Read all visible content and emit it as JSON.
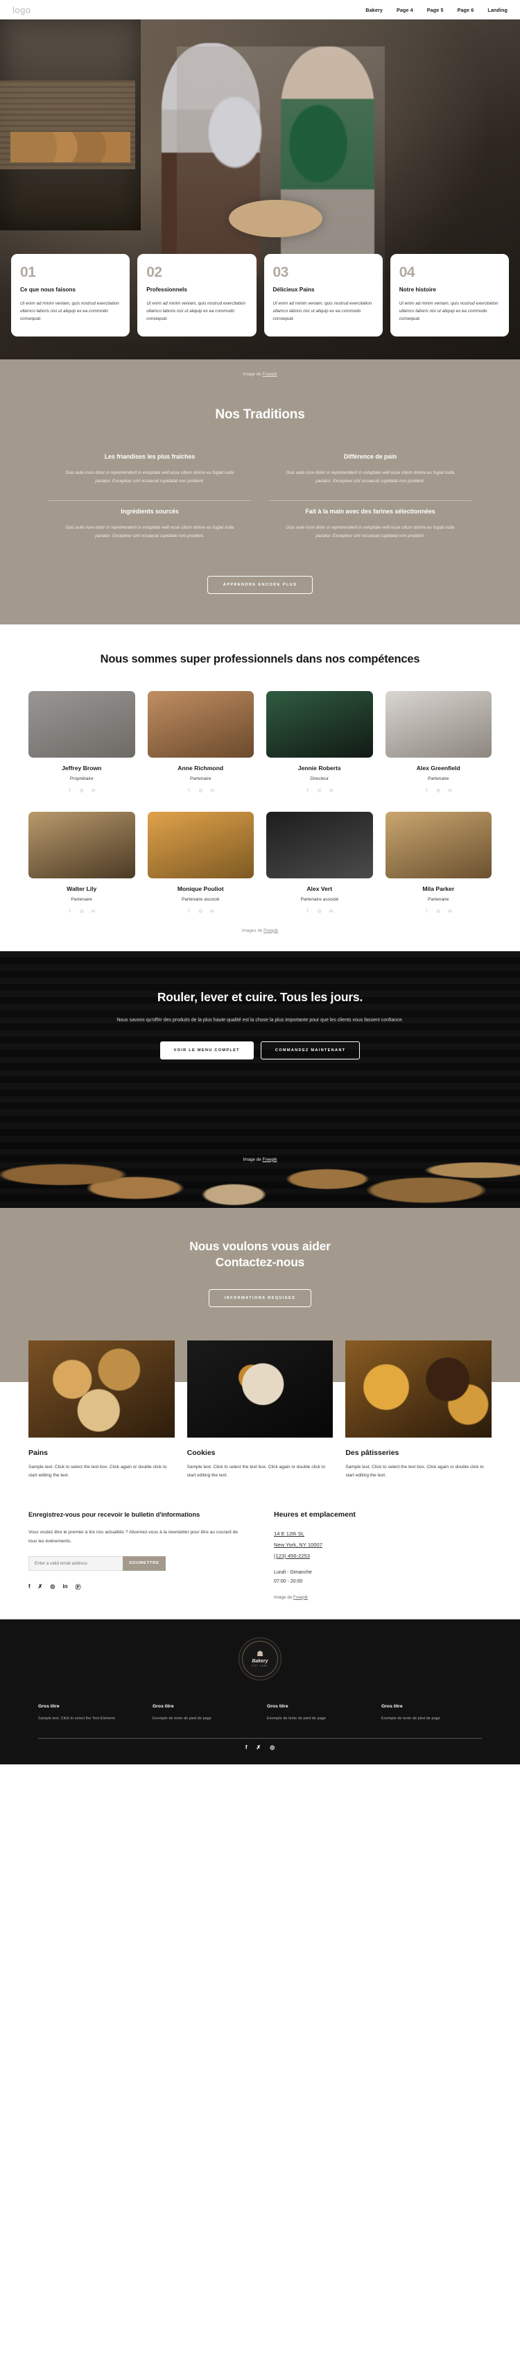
{
  "header": {
    "logo": "logo",
    "nav": [
      {
        "label": "Bakery"
      },
      {
        "label": "Page 4"
      },
      {
        "label": "Page 5"
      },
      {
        "label": "Page 6"
      },
      {
        "label": "Landing"
      }
    ]
  },
  "hero": {
    "credit_prefix": "Image de ",
    "credit_link": "Freepik",
    "cards": [
      {
        "num": "01",
        "title": "Ce que nous faisons",
        "text": "Ut enim ad minim veniam, quis nostrud exercitation ullamco laboris nisi ut aliquip ex ea commodo consequat."
      },
      {
        "num": "02",
        "title": "Professionnels",
        "text": "Ut enim ad minim veniam, quis nostrud exercitation ullamco laboris nisi ut aliquip ex ea commodo consequat."
      },
      {
        "num": "03",
        "title": "Délicieux Pains",
        "text": "Ut enim ad minim veniam, quis nostrud exercitation ullamco laboris nisi ut aliquip ex ea commodo consequat."
      },
      {
        "num": "04",
        "title": "Notre histoire",
        "text": "Ut enim ad minim veniam, quis nostrud exercitation ullamco laboris nisi ut aliquip ex ea commodo consequat."
      }
    ]
  },
  "traditions": {
    "title": "Nos Traditions",
    "body": "Duis aute irure dolor in reprehenderit in voluptate velit esse cillum dolore eu fugiat nulla pariatur. Excepteur sint occaecat cupidatat non proident.",
    "items": [
      {
        "heading": "Les friandises les plus fraîches"
      },
      {
        "heading": "Différence de pain"
      },
      {
        "heading": "Ingrédients sourcés"
      },
      {
        "heading": "Fait à la main avec des farines sélectionnées"
      }
    ],
    "button": "APPRENDRE ENCORE PLUS"
  },
  "team": {
    "title": "Nous sommes super professionnels dans nos compétences",
    "credit_prefix": "Images de ",
    "credit_link": "Freepik",
    "members": [
      {
        "name": "Jeffrey Brown",
        "role": "Propriétaire"
      },
      {
        "name": "Anne Richmond",
        "role": "Partenaire"
      },
      {
        "name": "Jennie Roberts",
        "role": "Directeur"
      },
      {
        "name": "Alex Greenfield",
        "role": "Partenaire"
      },
      {
        "name": "Walter Lily",
        "role": "Partenaire"
      },
      {
        "name": "Monique Pouliot",
        "role": "Partenaire associé"
      },
      {
        "name": "Alex Vert",
        "role": "Partenaire associé"
      },
      {
        "name": "Mila Parker",
        "role": "Partenaire"
      }
    ],
    "social_icons": [
      "facebook-icon",
      "instagram-icon",
      "linkedin-icon"
    ]
  },
  "cta": {
    "title": "Rouler, lever et cuire. Tous les jours.",
    "subtitle": "Nous savons qu'offrir des produits de la plus haute qualité est la chose la plus importante pour que les clients vous fassent confiance.",
    "primary_button": "VOIR LE MENU COMPLET",
    "secondary_button": "COMMANDEZ MAINTENANT",
    "credit_prefix": "Image de ",
    "credit_link": "Freepik"
  },
  "contact": {
    "title_line1": "Nous voulons vous aider",
    "title_line2": "Contactez-nous",
    "button": "INFORMATIONS REQUISES"
  },
  "products": [
    {
      "title": "Pains",
      "text": "Sample text. Click to select the text box. Click again or double click to start editing the text."
    },
    {
      "title": "Cookies",
      "text": "Sample text. Click to select the text box. Click again or double click to start editing the text."
    },
    {
      "title": "Des pâtisseries",
      "text": "Sample text. Click to select the text box. Click again or double click to start editing the text."
    }
  ],
  "newsletter": {
    "heading": "Enregistrez-vous pour recevoir le bulletin d'informations",
    "text": "Vous voulez être le premier à lire nos actualités ? Abonnez-vous à la newsletter pour être au courant de tous les événements.",
    "placeholder": "Enter a valid email address",
    "submit": "SOUMETTRE",
    "socials": [
      "facebook-icon",
      "twitter-icon",
      "instagram-icon",
      "linkedin-icon",
      "pinterest-icon"
    ]
  },
  "hours": {
    "heading": "Heures et emplacement",
    "address_line1": "14 E 12th St,",
    "address_line2": "New York, NY 10007",
    "phone": "(123) 456-2253",
    "days": "Lundi - Dimanche",
    "times": "07:00 - 20:00",
    "credit_prefix": "Image de ",
    "credit_link": "Freepik"
  },
  "footer": {
    "badge_title": "Bakery",
    "badge_sub": "EST 1984",
    "columns": [
      {
        "heading": "Gros titre",
        "text": "Sample text. Click to select the Text Element."
      },
      {
        "heading": "Gros titre",
        "text": "Exemple de texte de pied de page"
      },
      {
        "heading": "Gros titre",
        "text": "Exemple de texte de pied de page"
      },
      {
        "heading": "Gros titre",
        "text": "Exemple de texte de pied de page"
      }
    ],
    "socials": [
      "facebook-icon",
      "twitter-icon",
      "instagram-icon"
    ]
  }
}
